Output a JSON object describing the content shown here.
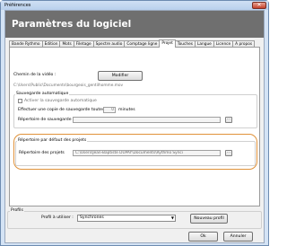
{
  "window": {
    "title": "Préférences",
    "close_label": "✕"
  },
  "header": {
    "title": "Paramètres du logiciel"
  },
  "tabs": [
    {
      "label": "Bande Rythmo",
      "active": false
    },
    {
      "label": "Edition",
      "active": false
    },
    {
      "label": "Mots",
      "active": false
    },
    {
      "label": "Filetage",
      "active": false
    },
    {
      "label": "Spectre audio",
      "active": false
    },
    {
      "label": "Comptage ligne",
      "active": false
    },
    {
      "label": "Projet",
      "active": true
    },
    {
      "label": "Touches",
      "active": false
    },
    {
      "label": "Langue",
      "active": false
    },
    {
      "label": "Licence",
      "active": false
    },
    {
      "label": "A propos",
      "active": false
    }
  ],
  "video": {
    "label": "Chemin de la vidéo :",
    "modify_button": "Modifier",
    "path": "C:\\Users\\Public\\Documents\\bourgeois_gentilhomme.mov"
  },
  "autosave": {
    "group_title": "Sauvegarde automatique",
    "enable_label": "Activer la sauvegarde automatique",
    "copy_label": "Effectuer une copie de sauvegarde toutes les",
    "minutes_value": "0",
    "minutes_label": "minutes",
    "dir_label": "Répertoire de sauvegarde :",
    "dir_value": "",
    "browse_label": "..."
  },
  "projects": {
    "group_title": "Répertoire par défaut des projets",
    "dir_label": "Répertoire des projets",
    "dir_value": "C:\\Users\\Jean-Baptiste DUPAY\\Documents\\Rythmo Synci",
    "browse_label": "..."
  },
  "profiles": {
    "group_title": "Profils",
    "use_label": "Profil à utiliser :",
    "selected": "Synchrones",
    "new_button": "Nouveau profil"
  },
  "footer": {
    "ok": "Ok",
    "cancel": "Annuler"
  }
}
